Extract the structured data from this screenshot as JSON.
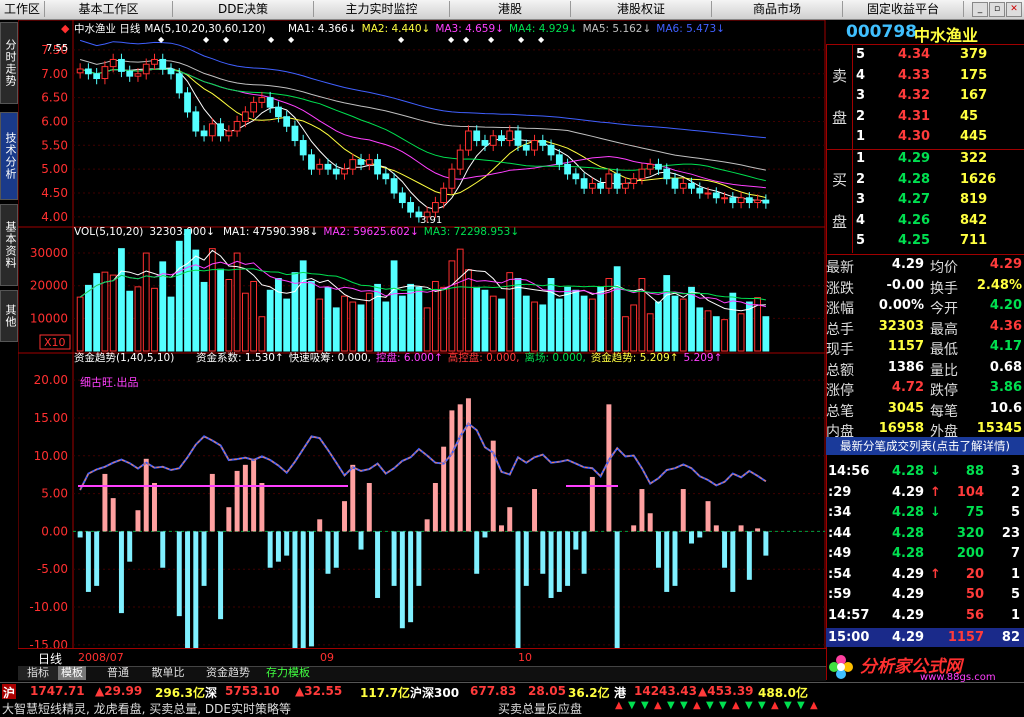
{
  "topbar": {
    "items": [
      "工作区",
      "基本工作区",
      "DDE决策",
      "主力实时监控",
      "港股",
      "港股权证",
      "商品市场",
      "固定收益平台"
    ]
  },
  "lefttabs": [
    "分时走势",
    "技术分析",
    "基本资料",
    "其他"
  ],
  "stock": {
    "code": "000798",
    "name": "中水渔业"
  },
  "chart_data": [
    {
      "type": "candlestick",
      "title": "中水渔业 日线",
      "ma_header": "MA(5,10,20,30,60,120)",
      "ma_values": [
        {
          "name": "MA1",
          "value": "4.366↓",
          "color": "#ffffff"
        },
        {
          "name": "MA2",
          "value": "4.440↓",
          "color": "#ffff40"
        },
        {
          "name": "MA3",
          "value": "4.659↓",
          "color": "#ff40ff"
        },
        {
          "name": "MA4",
          "value": "4.929↓",
          "color": "#00e050"
        },
        {
          "name": "MA5",
          "value": "5.162↓",
          "color": "#c0c0c0"
        },
        {
          "name": "MA6",
          "value": "5.473↓",
          "color": "#4060ff"
        }
      ],
      "yticks": [
        "7.50",
        "7.00",
        "6.50",
        "6.00",
        "5.50",
        "5.00",
        "4.50",
        "4.00"
      ],
      "ylim": [
        3.85,
        7.75
      ],
      "annotations": [
        "7.55",
        "3.91"
      ],
      "closes": [
        7.1,
        7.0,
        6.9,
        7.15,
        7.3,
        7.05,
        6.95,
        7.0,
        7.2,
        7.3,
        7.1,
        7.0,
        6.6,
        6.2,
        5.8,
        5.7,
        5.95,
        5.7,
        5.8,
        6.0,
        6.2,
        6.4,
        6.5,
        6.3,
        6.1,
        5.9,
        5.6,
        5.3,
        5.0,
        5.1,
        5.0,
        4.9,
        5.0,
        5.2,
        5.1,
        5.2,
        4.9,
        4.8,
        4.5,
        4.3,
        4.1,
        4.0,
        4.1,
        4.3,
        4.6,
        5.0,
        5.4,
        5.8,
        5.6,
        5.5,
        5.7,
        5.6,
        5.8,
        5.5,
        5.4,
        5.6,
        5.5,
        5.3,
        5.1,
        4.9,
        4.8,
        4.6,
        4.7,
        4.6,
        4.9,
        4.6,
        4.7,
        4.8,
        5.0,
        5.1,
        5.0,
        4.8,
        4.6,
        4.7,
        4.6,
        4.5,
        4.5,
        4.4,
        4.4,
        4.3,
        4.4,
        4.3,
        4.35,
        4.29
      ]
    },
    {
      "type": "bar",
      "title": "VOL(5,10,20)",
      "header": "32303.000↓",
      "ma_values": [
        {
          "name": "MA1",
          "value": "47590.398↓",
          "color": "#ffffff"
        },
        {
          "name": "MA2",
          "value": "59625.602↓",
          "color": "#ff40ff"
        },
        {
          "name": "MA3",
          "value": "72298.953↓",
          "color": "#00e050"
        }
      ],
      "yticks": [
        "30000",
        "20000",
        "10000"
      ],
      "unit": "X10",
      "ylim": [
        0,
        34000
      ]
    },
    {
      "type": "bar",
      "title": "资金趋势(1,40,5,10)",
      "legend": [
        {
          "name": "资金系数",
          "value": "1.530↑",
          "color": "#ffffff"
        },
        {
          "name": "快速吸筹",
          "value": "0.000,",
          "color": "#ffffff"
        },
        {
          "name": "控盘",
          "value": "6.000↑",
          "color": "#ff40ff"
        },
        {
          "name": "高控盘",
          "value": "0.000,",
          "color": "#ff3b3b"
        },
        {
          "name": "离场",
          "value": "0.000,",
          "color": "#00e050"
        },
        {
          "name": "资金趋势",
          "value": "5.209↑",
          "color": "#ffff40"
        },
        {
          "name": "",
          "value": "5.209↑",
          "color": "#ff40ff"
        }
      ],
      "yticks": [
        "20.00",
        "15.00",
        "10.00",
        "5.00",
        "0.00",
        "-5.00",
        "-10.00",
        "-15.00"
      ],
      "ylim": [
        -17,
        22
      ],
      "annotation": "细古旺.出品"
    }
  ],
  "time_axis": {
    "labels": [
      "2008/07",
      "09",
      "10"
    ],
    "period": "日线"
  },
  "quote": {
    "sell": [
      {
        "n": "5",
        "p": "4.34",
        "v": "379"
      },
      {
        "n": "4",
        "p": "4.33",
        "v": "175"
      },
      {
        "n": "3",
        "p": "4.32",
        "v": "167"
      },
      {
        "n": "2",
        "p": "4.31",
        "v": "45"
      },
      {
        "n": "1",
        "p": "4.30",
        "v": "445"
      }
    ],
    "buy": [
      {
        "n": "1",
        "p": "4.29",
        "v": "322"
      },
      {
        "n": "2",
        "p": "4.28",
        "v": "1626"
      },
      {
        "n": "3",
        "p": "4.27",
        "v": "819"
      },
      {
        "n": "4",
        "p": "4.26",
        "v": "842"
      },
      {
        "n": "5",
        "p": "4.25",
        "v": "711"
      }
    ],
    "sell_label": [
      "卖",
      "盘"
    ],
    "buy_label": [
      "买",
      "盘"
    ],
    "stats": [
      [
        "最新",
        "4.29",
        "均价",
        "4.29"
      ],
      [
        "涨跌",
        "-0.00",
        "换手",
        "2.48%"
      ],
      [
        "涨幅",
        "0.00%",
        "今开",
        "4.20"
      ],
      [
        "总手",
        "32303",
        "最高",
        "4.36"
      ],
      [
        "现手",
        "1157",
        "最低",
        "4.17"
      ],
      [
        "总额",
        "1386",
        "量比",
        "0.68"
      ],
      [
        "涨停",
        "4.72",
        "跌停",
        "3.86"
      ],
      [
        "总笔",
        "3045",
        "每笔",
        "10.6"
      ],
      [
        "内盘",
        "16958",
        "外盘",
        "15345"
      ]
    ],
    "tick_tooltip": "最新分笔成交列表(点击了解详情)",
    "ticks": [
      {
        "t": "14:56",
        "p": "4.28",
        "a": "↓",
        "v": "88",
        "n": "3"
      },
      {
        "t": ":29",
        "p": "4.29",
        "a": "↑",
        "v": "104",
        "n": "2"
      },
      {
        "t": ":34",
        "p": "4.28",
        "a": "↓",
        "v": "75",
        "n": "5"
      },
      {
        "t": ":44",
        "p": "4.28",
        "a": "",
        "v": "320",
        "n": "23"
      },
      {
        "t": ":49",
        "p": "4.28",
        "a": "",
        "v": "200",
        "n": "7"
      },
      {
        "t": ":54",
        "p": "4.29",
        "a": "↑",
        "v": "20",
        "n": "1"
      },
      {
        "t": ":59",
        "p": "4.29",
        "a": "",
        "v": "50",
        "n": "5"
      },
      {
        "t": "14:57",
        "p": "4.29",
        "a": "",
        "v": "56",
        "n": "1"
      },
      {
        "t": "15:00",
        "p": "4.29",
        "a": "",
        "v": "1157",
        "n": "82"
      }
    ]
  },
  "bottom_tabs": [
    "指标",
    "模板",
    "普通",
    "散单比",
    "资金趋势",
    "存力模板"
  ],
  "index_bar": {
    "sh": {
      "label": "沪",
      "value": "1747.71",
      "chg": "▲29.99",
      "amt": "296.3亿"
    },
    "sz": {
      "label": "深",
      "value": "5753.10",
      "chg": "▲32.55",
      "amt": "117.7亿"
    },
    "hs300": {
      "label": "沪深300",
      "value": "677.83",
      "chg": "28.05",
      "amt": "36.2亿"
    },
    "hk": {
      "label": "港",
      "value": "14243.43",
      "chg": "▲453.39",
      "amt": "488.0亿"
    }
  },
  "status_text": "大智慧短线精灵, 龙虎看盘, 买卖总量, DDE实时策略等",
  "status_right": "买卖总量反应盘",
  "watermark": {
    "title": "分析家公式网",
    "url": "www.88gs.com"
  }
}
